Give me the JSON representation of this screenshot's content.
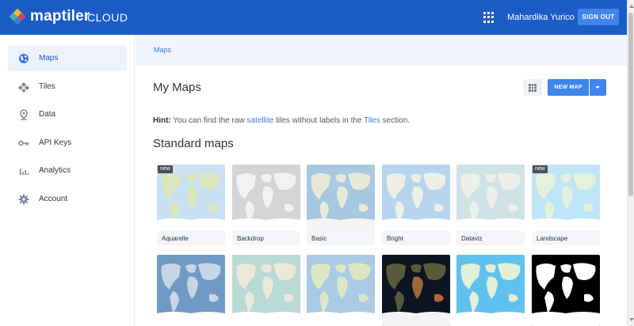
{
  "header": {
    "brand": "maptiler",
    "brand_suffix": "CLOUD",
    "apps_icon": "apps-grid-icon",
    "user_name": "Mahardika Yurico",
    "signout_label": "SIGN OUT"
  },
  "sidebar": {
    "items": [
      {
        "label": "Maps",
        "icon": "globe-icon",
        "active": true
      },
      {
        "label": "Tiles",
        "icon": "tiles-icon",
        "active": false
      },
      {
        "label": "Data",
        "icon": "location-pin-icon",
        "active": false
      },
      {
        "label": "API Keys",
        "icon": "key-icon",
        "active": false
      },
      {
        "label": "Analytics",
        "icon": "bar-chart-icon",
        "active": false
      },
      {
        "label": "Account",
        "icon": "gear-icon",
        "active": false
      }
    ]
  },
  "breadcrumb": "Maps",
  "main": {
    "title": "My Maps",
    "new_map_label": "NEW MAP",
    "hint": {
      "prefix": "Hint:",
      "text1": " You can find the raw ",
      "link1": "satellite",
      "text2": " tiles without labels in the ",
      "link2": "Tiles",
      "text3": " section."
    },
    "section_title": "Standard maps",
    "row1": [
      {
        "label": "Aquarelle",
        "badge": "new"
      },
      {
        "label": "Backdrop",
        "badge": ""
      },
      {
        "label": "Basic",
        "badge": ""
      },
      {
        "label": "Bright",
        "badge": ""
      },
      {
        "label": "Dataviz",
        "badge": ""
      },
      {
        "label": "Landscape",
        "badge": "new"
      }
    ],
    "row2": [
      {
        "label": "",
        "badge": ""
      },
      {
        "label": "",
        "badge": ""
      },
      {
        "label": "",
        "badge": ""
      },
      {
        "label": "",
        "badge": ""
      },
      {
        "label": "",
        "badge": ""
      },
      {
        "label": "",
        "badge": ""
      }
    ]
  },
  "colors": {
    "header_bg": "#1c5cc7",
    "accent": "#3e85ee",
    "link": "#3f78d8"
  }
}
